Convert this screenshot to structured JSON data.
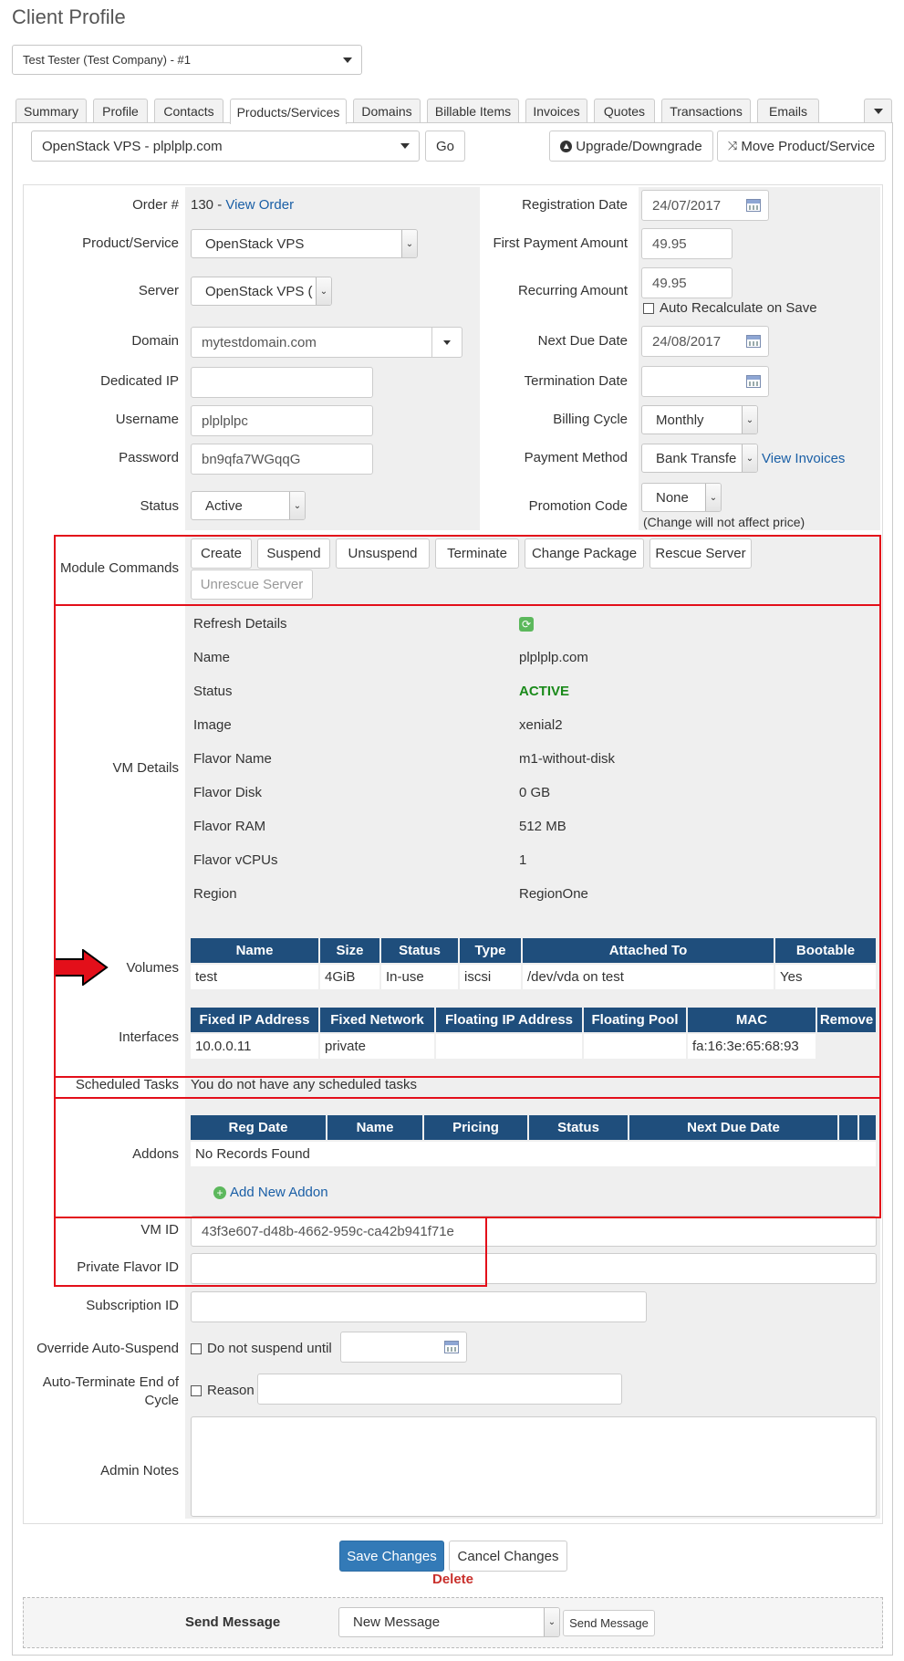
{
  "page": {
    "title": "Client Profile"
  },
  "client_select": {
    "value": "Test Tester (Test Company) - #1"
  },
  "tabs": [
    {
      "label": "Summary"
    },
    {
      "label": "Profile"
    },
    {
      "label": "Contacts"
    },
    {
      "label": "Products/Services"
    },
    {
      "label": "Domains"
    },
    {
      "label": "Billable Items"
    },
    {
      "label": "Invoices"
    },
    {
      "label": "Quotes"
    },
    {
      "label": "Transactions"
    },
    {
      "label": "Emails"
    }
  ],
  "toolbar": {
    "service_select": "OpenStack VPS - plplplp.com",
    "go": "Go",
    "upgrade": "Upgrade/Downgrade",
    "move": "Move Product/Service"
  },
  "left_fields": {
    "order_label": "Order #",
    "order_num": "130 - ",
    "order_link": "View Order",
    "product_label": "Product/Service",
    "product_value": "OpenStack VPS",
    "server_label": "Server",
    "server_value": "OpenStack VPS (",
    "domain_label": "Domain",
    "domain_value": "mytestdomain.com",
    "dedicated_ip_label": "Dedicated IP",
    "dedicated_ip_value": "",
    "username_label": "Username",
    "username_value": "plplplpc",
    "password_label": "Password",
    "password_value": "bn9qfa7WGqqG",
    "status_label": "Status",
    "status_value": "Active"
  },
  "right_fields": {
    "reg_date_label": "Registration Date",
    "reg_date_value": "24/07/2017",
    "first_payment_label": "First Payment Amount",
    "first_payment_value": "49.95",
    "recurring_label": "Recurring Amount",
    "recurring_value": "49.95",
    "auto_recalc": "Auto Recalculate on Save",
    "next_due_label": "Next Due Date",
    "next_due_value": "24/08/2017",
    "termination_label": "Termination Date",
    "termination_value": "",
    "billing_cycle_label": "Billing Cycle",
    "billing_cycle_value": "Monthly",
    "payment_method_label": "Payment Method",
    "payment_method_value": "Bank Transfe",
    "view_invoices": "View Invoices",
    "promo_label": "Promotion Code",
    "promo_value": "None",
    "promo_note": "(Change will not affect price)"
  },
  "module_commands": {
    "label": "Module Commands",
    "buttons": [
      "Create",
      "Suspend",
      "Unsuspend",
      "Terminate",
      "Change Package",
      "Rescue Server"
    ],
    "disabled_button": "Unrescue Server"
  },
  "vm_details": {
    "label": "VM Details",
    "rows": [
      {
        "key": "Refresh Details",
        "value": ""
      },
      {
        "key": "Name",
        "value": "plplplp.com"
      },
      {
        "key": "Status",
        "value": "ACTIVE"
      },
      {
        "key": "Image",
        "value": "xenial2"
      },
      {
        "key": "Flavor Name",
        "value": "m1-without-disk"
      },
      {
        "key": "Flavor Disk",
        "value": "0 GB"
      },
      {
        "key": "Flavor RAM",
        "value": "512 MB"
      },
      {
        "key": "Flavor vCPUs",
        "value": "1"
      },
      {
        "key": "Region",
        "value": "RegionOne"
      }
    ],
    "status_color": "#1a8a1a"
  },
  "volumes": {
    "label": "Volumes",
    "headers": [
      "Name",
      "Size",
      "Status",
      "Type",
      "Attached To",
      "Bootable"
    ],
    "rows": [
      [
        "test",
        "4GiB",
        "In-use",
        "iscsi",
        "/dev/vda on test",
        "Yes"
      ]
    ]
  },
  "interfaces": {
    "label": "Interfaces",
    "headers": [
      "Fixed IP Address",
      "Fixed Network",
      "Floating IP Address",
      "Floating Pool",
      "MAC",
      "Remove"
    ],
    "rows": [
      [
        "10.0.0.11",
        "private",
        "",
        "",
        "fa:16:3e:65:68:93",
        ""
      ]
    ]
  },
  "scheduled_tasks": {
    "label": "Scheduled Tasks",
    "text": "You do not have any scheduled tasks"
  },
  "addons": {
    "label": "Addons",
    "headers": [
      "Reg Date",
      "Name",
      "Pricing",
      "Status",
      "Next Due Date",
      "",
      ""
    ],
    "empty": "No Records Found",
    "add": "Add New Addon"
  },
  "custom_fields": {
    "vm_id_label": "VM ID",
    "vm_id_value": "43f3e607-d48b-4662-959c-ca42b941f71e",
    "private_flavor_label": "Private Flavor ID",
    "private_flavor_value": "",
    "subscription_label": "Subscription ID",
    "subscription_value": ""
  },
  "override": {
    "label": "Override Auto-Suspend",
    "text": "Do not suspend until",
    "date": ""
  },
  "auto_terminate": {
    "label_line1": "Auto-Terminate End of",
    "label_line2": "Cycle",
    "text": "Reason"
  },
  "admin_notes": {
    "label": "Admin Notes",
    "value": ""
  },
  "actions": {
    "save": "Save Changes",
    "cancel": "Cancel Changes",
    "delete": "Delete"
  },
  "send_message": {
    "label": "Send Message",
    "select": "New Message",
    "button": "Send Message"
  },
  "colors": {
    "accent": "#337ab7",
    "table_header": "#1f4e7c",
    "highlight": "#e30f1a",
    "link": "#1a5fa6",
    "delete": "#c9302c"
  }
}
